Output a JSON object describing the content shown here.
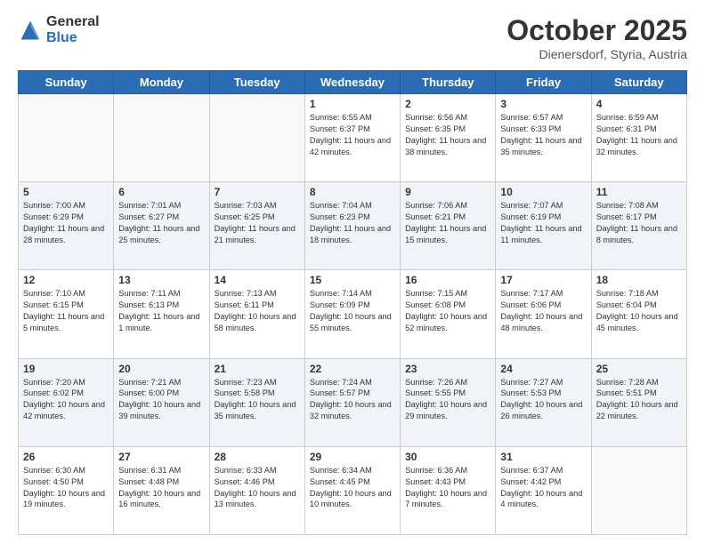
{
  "header": {
    "logo_general": "General",
    "logo_blue": "Blue",
    "month": "October 2025",
    "location": "Dienersdorf, Styria, Austria"
  },
  "weekdays": [
    "Sunday",
    "Monday",
    "Tuesday",
    "Wednesday",
    "Thursday",
    "Friday",
    "Saturday"
  ],
  "weeks": [
    [
      {
        "day": "",
        "sunrise": "",
        "sunset": "",
        "daylight": ""
      },
      {
        "day": "",
        "sunrise": "",
        "sunset": "",
        "daylight": ""
      },
      {
        "day": "",
        "sunrise": "",
        "sunset": "",
        "daylight": ""
      },
      {
        "day": "1",
        "sunrise": "6:55 AM",
        "sunset": "6:37 PM",
        "daylight": "11 hours and 42 minutes."
      },
      {
        "day": "2",
        "sunrise": "6:56 AM",
        "sunset": "6:35 PM",
        "daylight": "11 hours and 38 minutes."
      },
      {
        "day": "3",
        "sunrise": "6:57 AM",
        "sunset": "6:33 PM",
        "daylight": "11 hours and 35 minutes."
      },
      {
        "day": "4",
        "sunrise": "6:59 AM",
        "sunset": "6:31 PM",
        "daylight": "11 hours and 32 minutes."
      }
    ],
    [
      {
        "day": "5",
        "sunrise": "7:00 AM",
        "sunset": "6:29 PM",
        "daylight": "11 hours and 28 minutes."
      },
      {
        "day": "6",
        "sunrise": "7:01 AM",
        "sunset": "6:27 PM",
        "daylight": "11 hours and 25 minutes."
      },
      {
        "day": "7",
        "sunrise": "7:03 AM",
        "sunset": "6:25 PM",
        "daylight": "11 hours and 21 minutes."
      },
      {
        "day": "8",
        "sunrise": "7:04 AM",
        "sunset": "6:23 PM",
        "daylight": "11 hours and 18 minutes."
      },
      {
        "day": "9",
        "sunrise": "7:06 AM",
        "sunset": "6:21 PM",
        "daylight": "11 hours and 15 minutes."
      },
      {
        "day": "10",
        "sunrise": "7:07 AM",
        "sunset": "6:19 PM",
        "daylight": "11 hours and 11 minutes."
      },
      {
        "day": "11",
        "sunrise": "7:08 AM",
        "sunset": "6:17 PM",
        "daylight": "11 hours and 8 minutes."
      }
    ],
    [
      {
        "day": "12",
        "sunrise": "7:10 AM",
        "sunset": "6:15 PM",
        "daylight": "11 hours and 5 minutes."
      },
      {
        "day": "13",
        "sunrise": "7:11 AM",
        "sunset": "6:13 PM",
        "daylight": "11 hours and 1 minute."
      },
      {
        "day": "14",
        "sunrise": "7:13 AM",
        "sunset": "6:11 PM",
        "daylight": "10 hours and 58 minutes."
      },
      {
        "day": "15",
        "sunrise": "7:14 AM",
        "sunset": "6:09 PM",
        "daylight": "10 hours and 55 minutes."
      },
      {
        "day": "16",
        "sunrise": "7:15 AM",
        "sunset": "6:08 PM",
        "daylight": "10 hours and 52 minutes."
      },
      {
        "day": "17",
        "sunrise": "7:17 AM",
        "sunset": "6:06 PM",
        "daylight": "10 hours and 48 minutes."
      },
      {
        "day": "18",
        "sunrise": "7:18 AM",
        "sunset": "6:04 PM",
        "daylight": "10 hours and 45 minutes."
      }
    ],
    [
      {
        "day": "19",
        "sunrise": "7:20 AM",
        "sunset": "6:02 PM",
        "daylight": "10 hours and 42 minutes."
      },
      {
        "day": "20",
        "sunrise": "7:21 AM",
        "sunset": "6:00 PM",
        "daylight": "10 hours and 39 minutes."
      },
      {
        "day": "21",
        "sunrise": "7:23 AM",
        "sunset": "5:58 PM",
        "daylight": "10 hours and 35 minutes."
      },
      {
        "day": "22",
        "sunrise": "7:24 AM",
        "sunset": "5:57 PM",
        "daylight": "10 hours and 32 minutes."
      },
      {
        "day": "23",
        "sunrise": "7:26 AM",
        "sunset": "5:55 PM",
        "daylight": "10 hours and 29 minutes."
      },
      {
        "day": "24",
        "sunrise": "7:27 AM",
        "sunset": "5:53 PM",
        "daylight": "10 hours and 26 minutes."
      },
      {
        "day": "25",
        "sunrise": "7:28 AM",
        "sunset": "5:51 PM",
        "daylight": "10 hours and 22 minutes."
      }
    ],
    [
      {
        "day": "26",
        "sunrise": "6:30 AM",
        "sunset": "4:50 PM",
        "daylight": "10 hours and 19 minutes."
      },
      {
        "day": "27",
        "sunrise": "6:31 AM",
        "sunset": "4:48 PM",
        "daylight": "10 hours and 16 minutes."
      },
      {
        "day": "28",
        "sunrise": "6:33 AM",
        "sunset": "4:46 PM",
        "daylight": "10 hours and 13 minutes."
      },
      {
        "day": "29",
        "sunrise": "6:34 AM",
        "sunset": "4:45 PM",
        "daylight": "10 hours and 10 minutes."
      },
      {
        "day": "30",
        "sunrise": "6:36 AM",
        "sunset": "4:43 PM",
        "daylight": "10 hours and 7 minutes."
      },
      {
        "day": "31",
        "sunrise": "6:37 AM",
        "sunset": "4:42 PM",
        "daylight": "10 hours and 4 minutes."
      },
      {
        "day": "",
        "sunrise": "",
        "sunset": "",
        "daylight": ""
      }
    ]
  ]
}
